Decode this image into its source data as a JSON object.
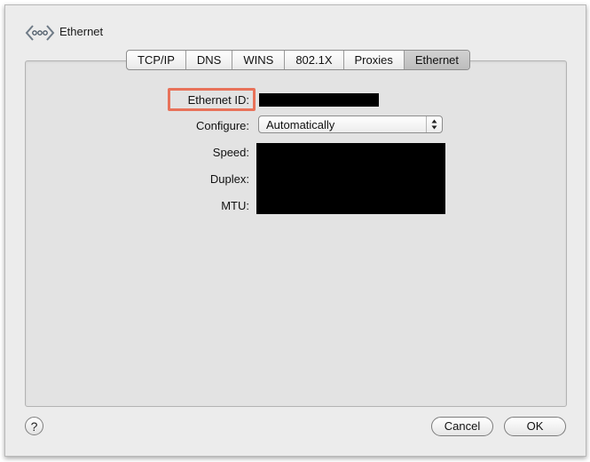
{
  "header": {
    "title": "Ethernet",
    "icon": "ethernet-network-icon"
  },
  "tabs": [
    {
      "label": "TCP/IP",
      "selected": false
    },
    {
      "label": "DNS",
      "selected": false
    },
    {
      "label": "WINS",
      "selected": false
    },
    {
      "label": "802.1X",
      "selected": false
    },
    {
      "label": "Proxies",
      "selected": false
    },
    {
      "label": "Ethernet",
      "selected": true
    }
  ],
  "form": {
    "ethernet_id_label": "Ethernet ID:",
    "configure_label": "Configure:",
    "configure_value": "Automatically",
    "speed_label": "Speed:",
    "duplex_label": "Duplex:",
    "mtu_label": "MTU:"
  },
  "footer": {
    "help_label": "?",
    "cancel_label": "Cancel",
    "ok_label": "OK"
  },
  "colors": {
    "highlight": "#e8725a",
    "redaction": "#000000"
  }
}
